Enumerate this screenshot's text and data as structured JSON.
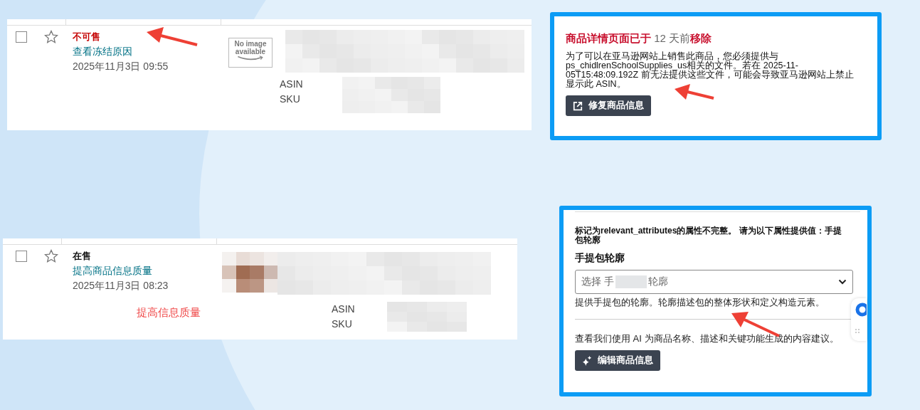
{
  "listings": [
    {
      "checked": false,
      "starred": false,
      "status": {
        "text": "不可售",
        "color": "#c40000"
      },
      "link": "查看冻结原因",
      "date": "2025年11月3日 09:55",
      "image": {
        "kind": "placeholder",
        "text": "No image available"
      },
      "asin_label": "ASIN",
      "sku_label": "SKU"
    },
    {
      "checked": false,
      "starred": false,
      "status": {
        "text": "在售",
        "color": "#111111"
      },
      "link": "提高商品信息质量",
      "date": "2025年11月3日 08:23",
      "image": {
        "kind": "pixelated"
      },
      "asin_label": "ASIN",
      "sku_label": "SKU",
      "note": "提高信息质量"
    }
  ],
  "alert_panel": {
    "title": [
      {
        "text": "商品详情页面已于",
        "kind": "alert"
      },
      {
        "text": " 12 天前",
        "kind": "plain"
      },
      {
        "text": "移除",
        "kind": "alert"
      }
    ],
    "body": "为了可以在亚马逊网站上销售此商品，您必须提供与 ps_chidlrenSchoolSupplies_us相关的文件。若在 2025-11-05T15:48:09.192Z 前无法提供这些文件，可能会导致亚马逊网站上禁止显示此 ASIN。",
    "button": "修复商品信息"
  },
  "attribute_panel": {
    "message": "标记为relevant_attributes的属性不完整。 请为以下属性提供值：手提包轮廓",
    "field_label": "手提包轮廓",
    "select_text": [
      "选择 手",
      "轮廓"
    ],
    "hint": "提供手提包的轮廓。轮廓描述包的整体形状和定义构造元素。",
    "ai_text": "查看我们使用 AI 为商品名称、描述和关键功能生成的内容建议。",
    "button": "编辑商品信息"
  }
}
